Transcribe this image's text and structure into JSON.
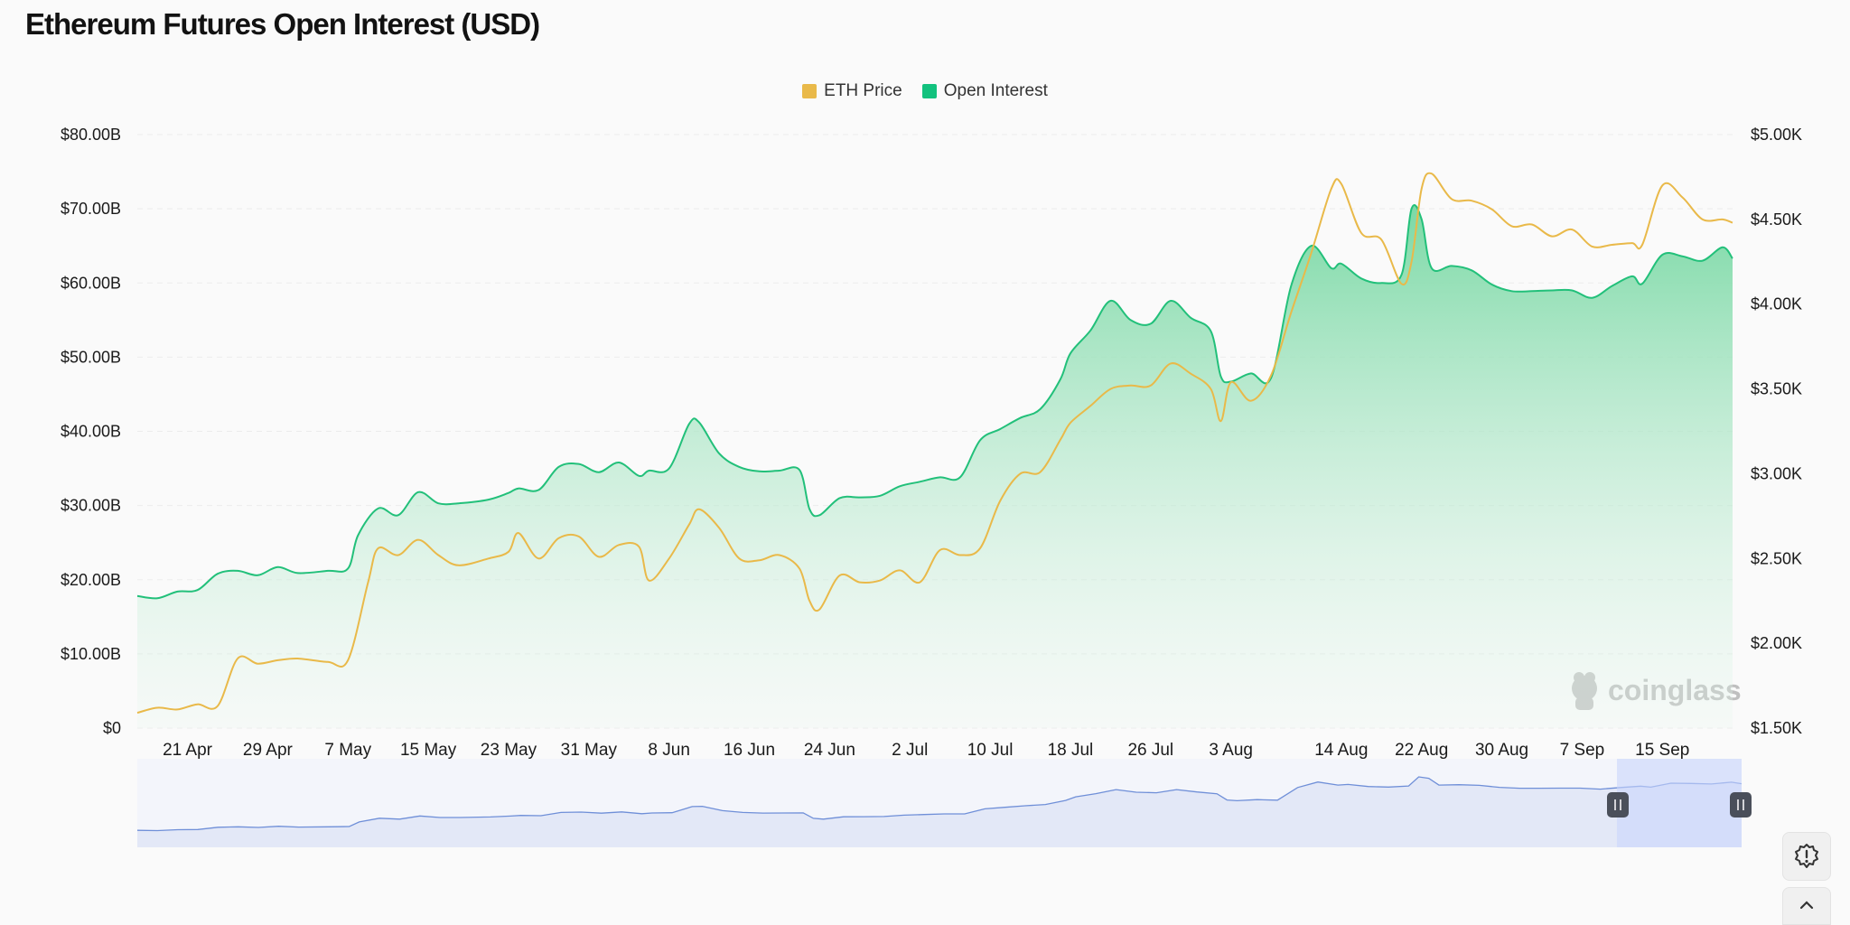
{
  "title": "Ethereum Futures Open Interest (USD)",
  "watermark": "coinglass",
  "colors": {
    "price": "#e9b949",
    "oi": "#22c07a",
    "oi_fill_top": "#7dd8a6",
    "navigator_line": "#6f8fd8",
    "navigator_fill": "#e3e8f7",
    "navigator_selection": "#d2dcfa"
  },
  "icons": {
    "settings": "warning-gear-icon",
    "scroll_up": "chevron-up-icon"
  },
  "chart_data": {
    "type": "area",
    "title": "Ethereum Futures Open Interest (USD)",
    "legend_position": "top-center",
    "grid": true,
    "x_ticks": [
      "21 Apr",
      "29 Apr",
      "7 May",
      "15 May",
      "23 May",
      "31 May",
      "8 Jun",
      "16 Jun",
      "24 Jun",
      "2 Jul",
      "10 Jul",
      "18 Jul",
      "26 Jul",
      "3 Aug",
      "14 Aug",
      "22 Aug",
      "30 Aug",
      "7 Sep",
      "15 Sep"
    ],
    "y_left": {
      "ticks": [
        "$0",
        "$10.00B",
        "$20.00B",
        "$30.00B",
        "$40.00B",
        "$50.00B",
        "$60.00B",
        "$70.00B",
        "$80.00B"
      ],
      "range": [
        0,
        80
      ]
    },
    "y_right": {
      "ticks": [
        "$1.50K",
        "$2.00K",
        "$2.50K",
        "$3.00K",
        "$3.50K",
        "$4.00K",
        "$4.50K",
        "$5.00K"
      ],
      "range": [
        1500,
        5000
      ]
    },
    "series": [
      {
        "name": "ETH Price",
        "axis": "right",
        "unit": "USD",
        "x": [
          "16 Apr",
          "18 Apr",
          "20 Apr",
          "22 Apr",
          "24 Apr",
          "26 Apr",
          "28 Apr",
          "30 Apr",
          "2 May",
          "5 May",
          "7 May",
          "9 May",
          "10 May",
          "12 May",
          "14 May",
          "16 May",
          "18 May",
          "21 May",
          "23 May",
          "24 May",
          "26 May",
          "28 May",
          "30 May",
          "1 Jun",
          "3 Jun",
          "5 Jun",
          "6 Jun",
          "8 Jun",
          "10 Jun",
          "11 Jun",
          "13 Jun",
          "15 Jun",
          "17 Jun",
          "19 Jun",
          "21 Jun",
          "22 Jun",
          "23 Jun",
          "25 Jun",
          "27 Jun",
          "29 Jun",
          "1 Jul",
          "3 Jul",
          "5 Jul",
          "7 Jul",
          "9 Jul",
          "11 Jul",
          "13 Jul",
          "15 Jul",
          "17 Jul",
          "18 Jul",
          "20 Jul",
          "22 Jul",
          "24 Jul",
          "26 Jul",
          "28 Jul",
          "30 Jul",
          "1 Aug",
          "2 Aug",
          "3 Aug",
          "5 Aug",
          "7 Aug",
          "9 Aug",
          "11 Aug",
          "13 Aug",
          "14 Aug",
          "16 Aug",
          "18 Aug",
          "20 Aug",
          "21 Aug",
          "22 Aug",
          "23 Aug",
          "25 Aug",
          "27 Aug",
          "29 Aug",
          "31 Aug",
          "2 Sep",
          "4 Sep",
          "6 Sep",
          "8 Sep",
          "10 Sep",
          "12 Sep",
          "13 Sep",
          "15 Sep",
          "17 Sep",
          "19 Sep",
          "21 Sep",
          "22 Sep"
        ],
        "values": [
          1590,
          1620,
          1610,
          1640,
          1630,
          1910,
          1880,
          1900,
          1910,
          1890,
          1900,
          2360,
          2560,
          2520,
          2610,
          2520,
          2460,
          2500,
          2540,
          2650,
          2500,
          2620,
          2630,
          2510,
          2580,
          2570,
          2370,
          2500,
          2700,
          2790,
          2680,
          2500,
          2490,
          2520,
          2440,
          2250,
          2200,
          2400,
          2360,
          2370,
          2430,
          2360,
          2550,
          2520,
          2560,
          2840,
          3000,
          3010,
          3200,
          3300,
          3400,
          3500,
          3520,
          3520,
          3650,
          3590,
          3500,
          3310,
          3540,
          3430,
          3580,
          3950,
          4300,
          4680,
          4710,
          4420,
          4380,
          4120,
          4250,
          4680,
          4770,
          4620,
          4610,
          4560,
          4460,
          4470,
          4400,
          4440,
          4340,
          4350,
          4360,
          4350,
          4700,
          4630,
          4500,
          4500,
          4480
        ]
      },
      {
        "name": "Open Interest",
        "axis": "left",
        "unit": "USD billions",
        "x": [
          "16 Apr",
          "18 Apr",
          "20 Apr",
          "22 Apr",
          "24 Apr",
          "26 Apr",
          "28 Apr",
          "30 Apr",
          "2 May",
          "5 May",
          "7 May",
          "8 May",
          "10 May",
          "12 May",
          "14 May",
          "16 May",
          "18 May",
          "21 May",
          "23 May",
          "24 May",
          "26 May",
          "28 May",
          "30 May",
          "1 Jun",
          "3 Jun",
          "5 Jun",
          "6 Jun",
          "8 Jun",
          "10 Jun",
          "11 Jun",
          "13 Jun",
          "15 Jun",
          "17 Jun",
          "19 Jun",
          "21 Jun",
          "22 Jun",
          "23 Jun",
          "25 Jun",
          "27 Jun",
          "29 Jun",
          "1 Jul",
          "3 Jul",
          "5 Jul",
          "7 Jul",
          "9 Jul",
          "11 Jul",
          "13 Jul",
          "15 Jul",
          "17 Jul",
          "18 Jul",
          "20 Jul",
          "22 Jul",
          "24 Jul",
          "26 Jul",
          "28 Jul",
          "30 Jul",
          "1 Aug",
          "2 Aug",
          "3 Aug",
          "5 Aug",
          "7 Aug",
          "9 Aug",
          "11 Aug",
          "13 Aug",
          "14 Aug",
          "16 Aug",
          "18 Aug",
          "20 Aug",
          "21 Aug",
          "22 Aug",
          "23 Aug",
          "25 Aug",
          "27 Aug",
          "29 Aug",
          "31 Aug",
          "2 Sep",
          "4 Sep",
          "6 Sep",
          "8 Sep",
          "10 Sep",
          "12 Sep",
          "13 Sep",
          "15 Sep",
          "17 Sep",
          "19 Sep",
          "21 Sep",
          "22 Sep"
        ],
        "values": [
          17.8,
          17.5,
          18.4,
          18.6,
          20.8,
          21.2,
          20.6,
          21.7,
          20.9,
          21.2,
          21.5,
          26.0,
          29.6,
          28.7,
          31.8,
          30.3,
          30.3,
          30.8,
          31.7,
          32.3,
          32.1,
          35.2,
          35.6,
          34.5,
          35.8,
          34.0,
          34.7,
          35.0,
          41.0,
          41.2,
          37.0,
          35.2,
          34.6,
          34.7,
          34.8,
          29.5,
          28.7,
          31.0,
          31.1,
          31.3,
          32.6,
          33.2,
          33.8,
          33.8,
          38.8,
          40.3,
          41.8,
          43.0,
          47.0,
          50.5,
          53.6,
          57.6,
          55.0,
          54.5,
          57.6,
          55.3,
          53.5,
          47.4,
          46.7,
          47.8,
          47.2,
          59.6,
          65.0,
          62.0,
          62.6,
          60.6,
          60.0,
          61.1,
          70.0,
          68.6,
          62.0,
          62.3,
          61.7,
          59.8,
          58.9,
          58.9,
          59.0,
          59.0,
          58.0,
          59.6,
          60.9,
          59.9,
          63.8,
          63.6,
          63.0,
          64.8,
          63.3
        ]
      }
    ]
  }
}
